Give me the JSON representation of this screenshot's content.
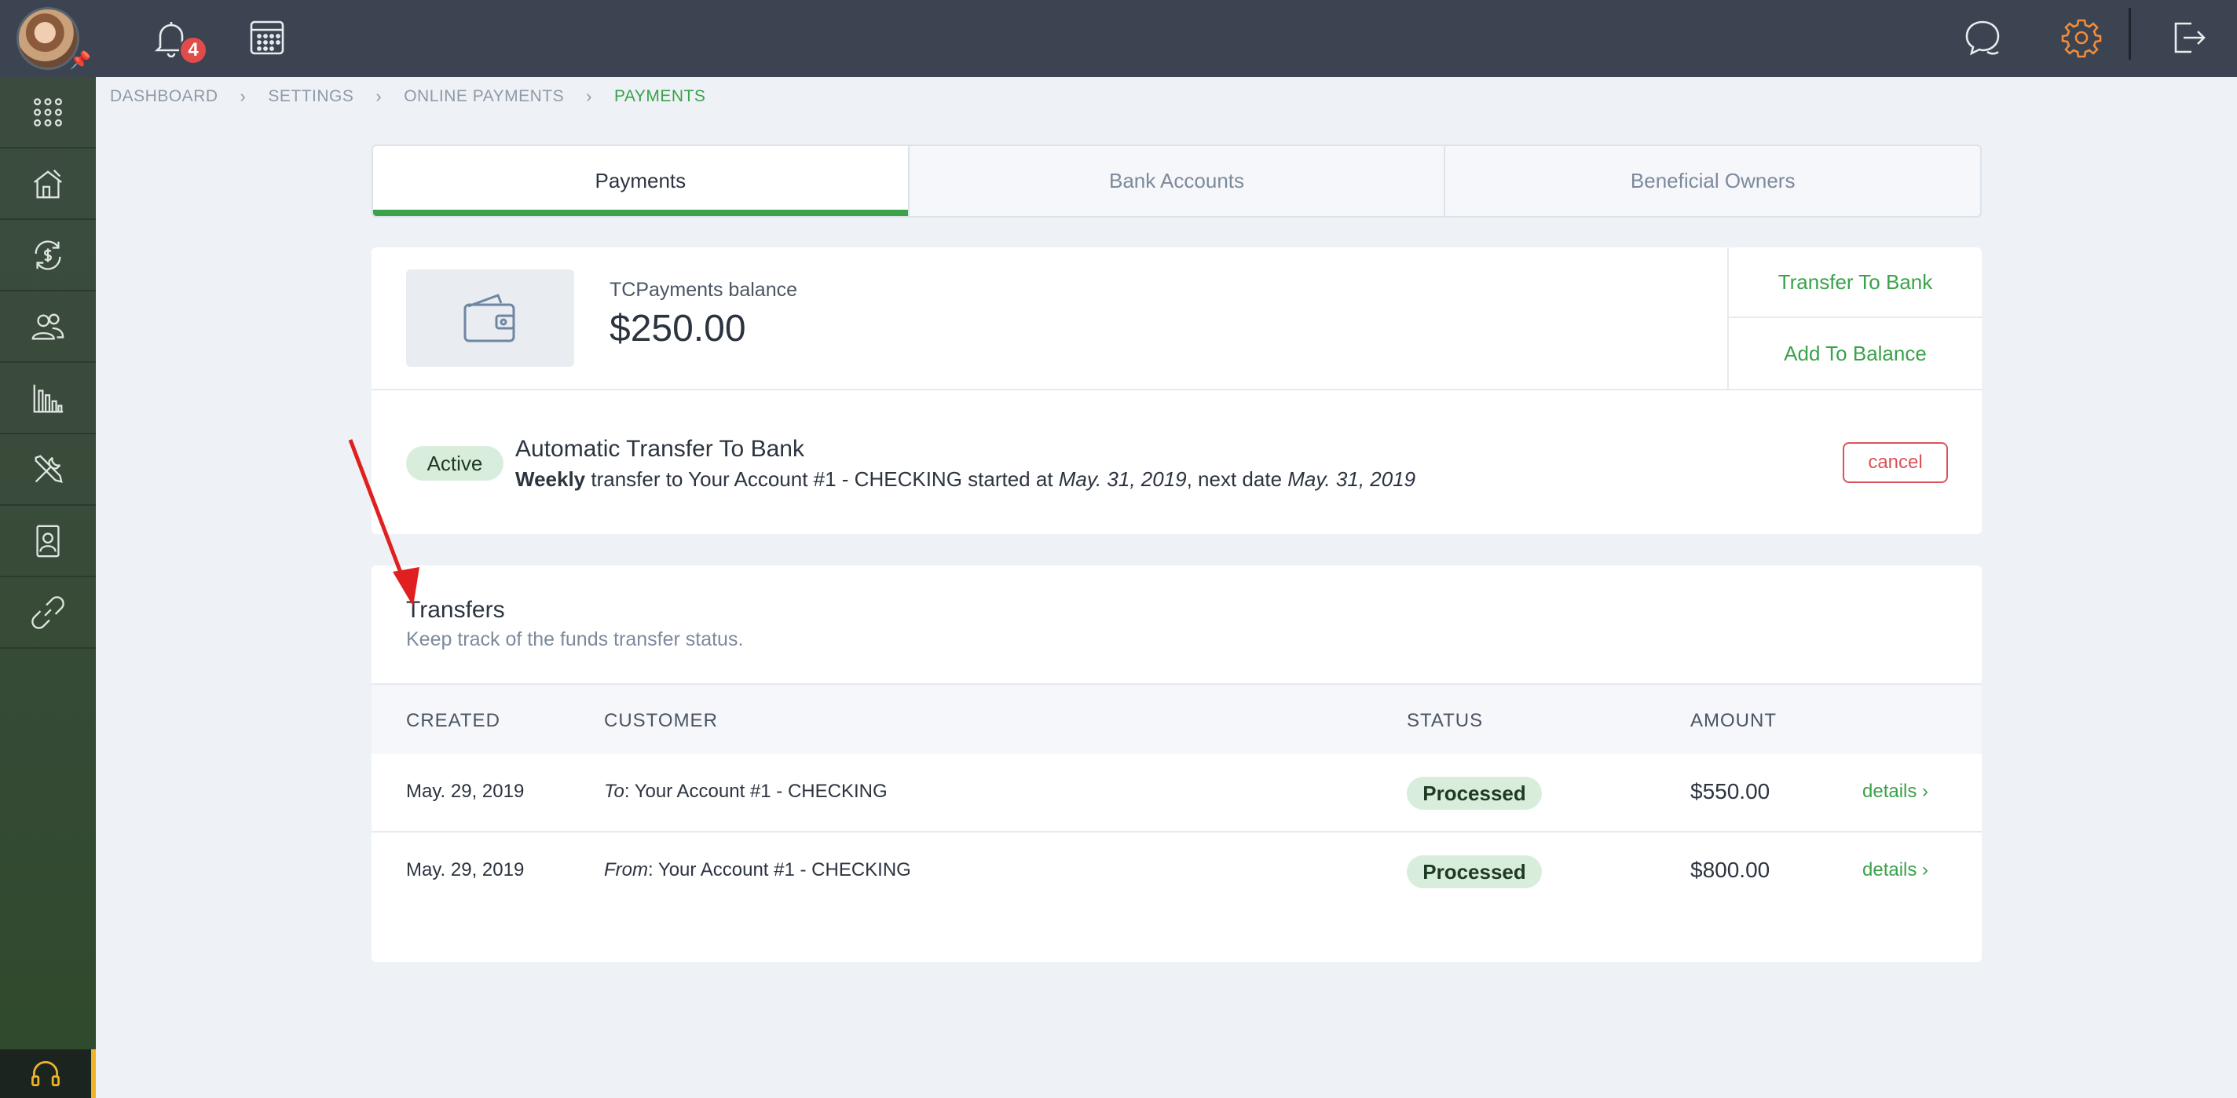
{
  "topbar": {
    "notification_count": "4"
  },
  "breadcrumb": [
    "DASHBOARD",
    "SETTINGS",
    "ONLINE PAYMENTS",
    "PAYMENTS"
  ],
  "tabs": [
    {
      "label": "Payments",
      "active": true
    },
    {
      "label": "Bank Accounts",
      "active": false
    },
    {
      "label": "Beneficial Owners",
      "active": false
    }
  ],
  "balance": {
    "label": "TCPayments balance",
    "value": "$250.00",
    "actions": [
      "Transfer To Bank",
      "Add To Balance"
    ]
  },
  "auto_transfer": {
    "status": "Active",
    "title": "Automatic Transfer To Bank",
    "frequency": "Weekly",
    "text1": " transfer to Your Account #1 - CHECKING started at ",
    "start_date": "May. 31, 2019",
    "text2": ", next date ",
    "next_date": "May. 31, 2019",
    "cancel_label": "cancel"
  },
  "transfers": {
    "title": "Transfers",
    "subtitle": "Keep track of the funds transfer status.",
    "columns": [
      "CREATED",
      "CUSTOMER",
      "STATUS",
      "AMOUNT"
    ],
    "rows": [
      {
        "created": "May. 29, 2019",
        "direction": "To",
        "customer": ": Your Account #1 - CHECKING",
        "status": "Processed",
        "amount": "$550.00",
        "details": "details ›"
      },
      {
        "created": "May. 29, 2019",
        "direction": "From",
        "customer": ": Your Account #1 - CHECKING",
        "status": "Processed",
        "amount": "$800.00",
        "details": "details ›"
      }
    ]
  },
  "colors": {
    "accent": "#3aa24a",
    "danger": "#d9535a",
    "topbar": "#3b4450"
  },
  "icons": {
    "sidebar": [
      "apps-grid-icon",
      "home-tools-icon",
      "exchange-dollar-icon",
      "users-icon",
      "chart-icon",
      "tools-icon",
      "contact-card-icon",
      "link-icon",
      "headset-icon"
    ],
    "topbar": [
      "bell-icon",
      "calendar-icon",
      "chat-icon",
      "gear-icon",
      "logout-icon"
    ]
  }
}
